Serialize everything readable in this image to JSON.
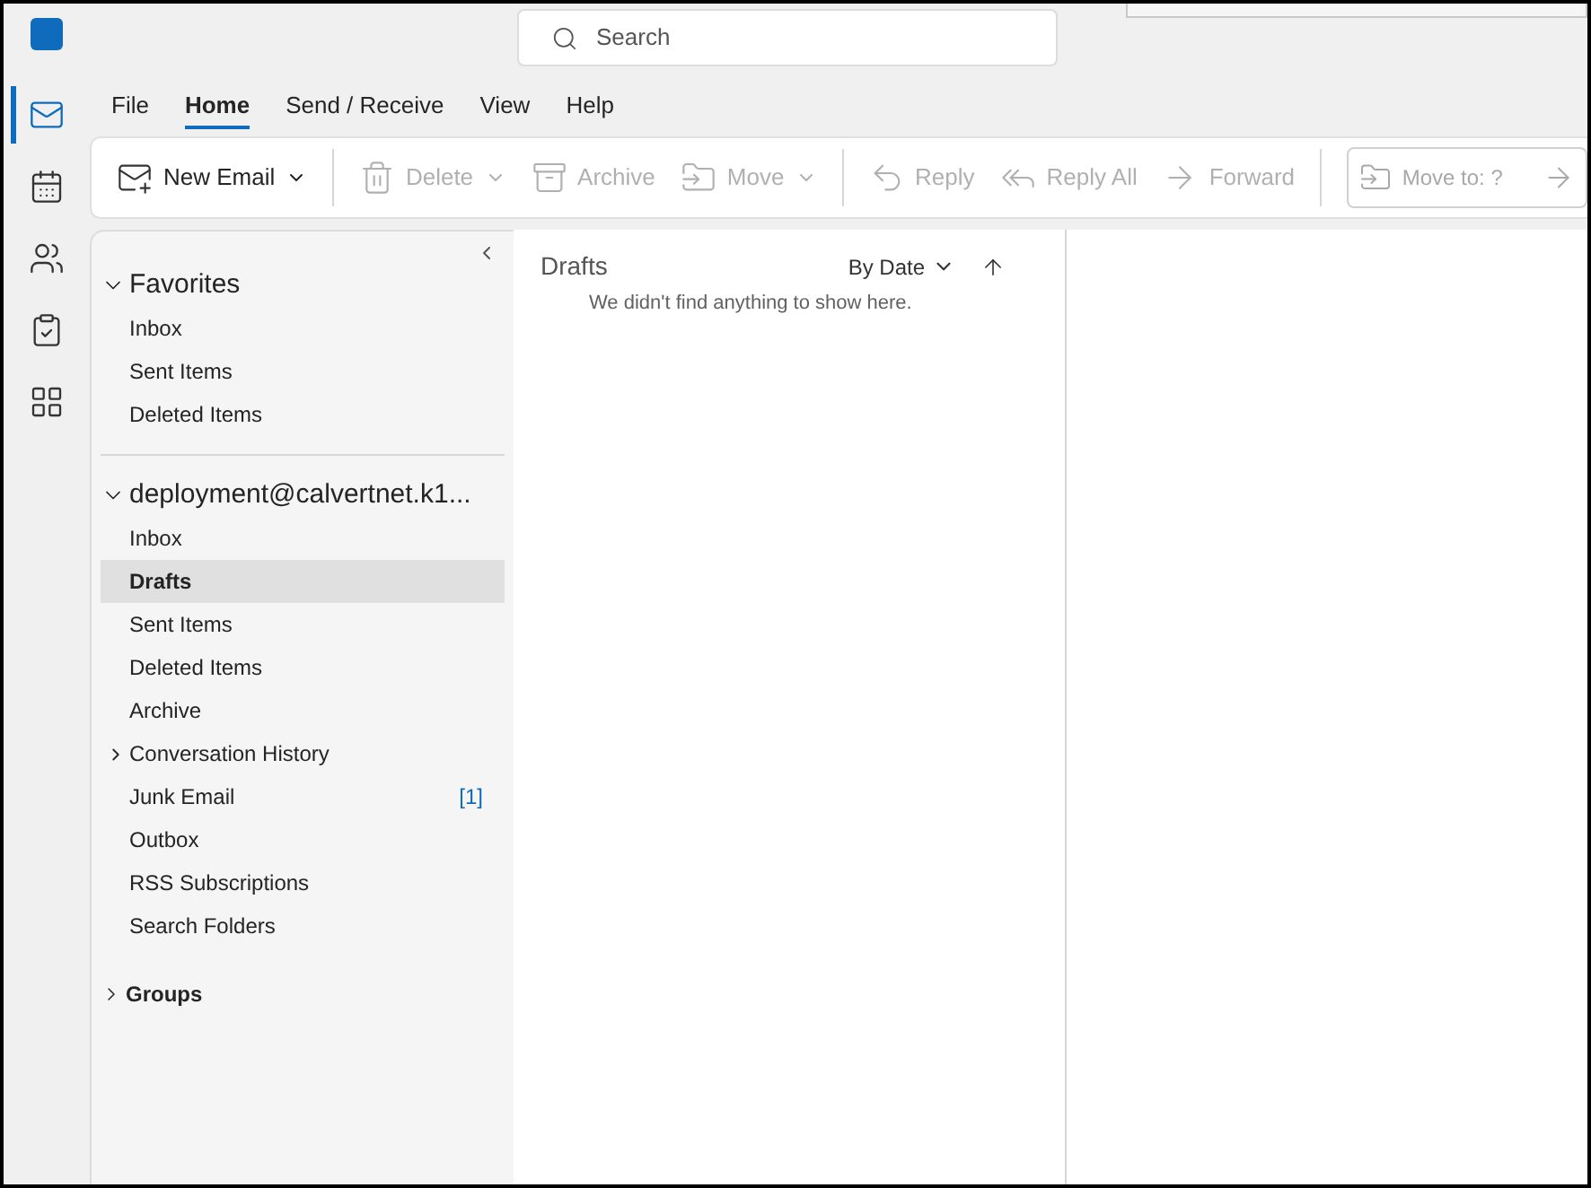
{
  "search": {
    "placeholder": "Search"
  },
  "nav_rail": [
    {
      "kind": "mail",
      "selected": true
    },
    {
      "kind": "calendar",
      "selected": false
    },
    {
      "kind": "people",
      "selected": false
    },
    {
      "kind": "tasks",
      "selected": false
    },
    {
      "kind": "apps",
      "selected": false
    }
  ],
  "menu_tabs": [
    {
      "label": "File",
      "selected": false
    },
    {
      "label": "Home",
      "selected": true
    },
    {
      "label": "Send / Receive",
      "selected": false
    },
    {
      "label": "View",
      "selected": false
    },
    {
      "label": "Help",
      "selected": false
    }
  ],
  "ribbon": [
    [
      {
        "kind": "new-email",
        "label": "New Email",
        "disabled": false,
        "dropdown": true
      }
    ],
    [
      {
        "kind": "delete",
        "label": "Delete",
        "disabled": true,
        "dropdown": true
      },
      {
        "kind": "archive",
        "label": "Archive",
        "disabled": true,
        "dropdown": false
      },
      {
        "kind": "move",
        "label": "Move",
        "disabled": true,
        "dropdown": true
      }
    ],
    [
      {
        "kind": "reply",
        "label": "Reply",
        "disabled": true,
        "dropdown": false
      },
      {
        "kind": "reply-all",
        "label": "Reply All",
        "disabled": true,
        "dropdown": false
      },
      {
        "kind": "forward",
        "label": "Forward",
        "disabled": true,
        "dropdown": false
      }
    ]
  ],
  "quick_step": {
    "label": "Move to: ?",
    "disabled": true
  },
  "folder_groups": [
    {
      "name": "Favorites",
      "expanded": true,
      "folders": [
        {
          "name": "Inbox",
          "selected": false
        },
        {
          "name": "Sent Items",
          "selected": false
        },
        {
          "name": "Deleted Items",
          "selected": false
        }
      ]
    },
    {
      "name": "deployment@calvertnet.k1...",
      "expanded": true,
      "folders": [
        {
          "name": "Inbox",
          "selected": false
        },
        {
          "name": "Drafts",
          "selected": true
        },
        {
          "name": "Sent Items",
          "selected": false
        },
        {
          "name": "Deleted Items",
          "selected": false
        },
        {
          "name": "Archive",
          "selected": false
        },
        {
          "name": "Conversation History",
          "selected": false,
          "expanded": false
        },
        {
          "name": "Junk Email",
          "selected": false,
          "count": "[1]"
        },
        {
          "name": "Outbox",
          "selected": false
        },
        {
          "name": "RSS Subscriptions",
          "selected": false
        },
        {
          "name": "Search Folders",
          "selected": false
        }
      ]
    },
    {
      "name": "Groups",
      "expanded": false
    }
  ],
  "message_list": {
    "title": "Drafts",
    "sort": "By Date",
    "empty_text": "We didn't find anything to show here."
  }
}
